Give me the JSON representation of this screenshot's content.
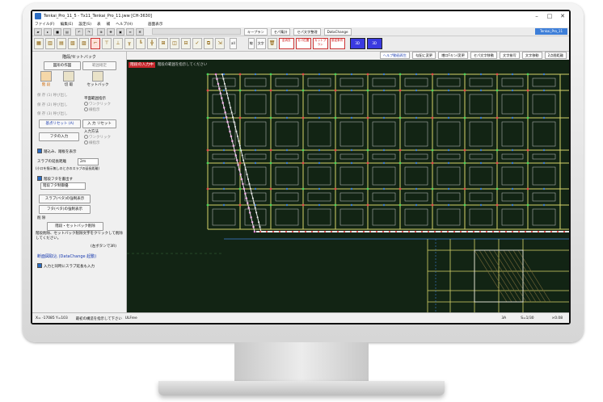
{
  "window": {
    "title": "Tenkai_Pro_11_5 - Tx11_Tenkai_Pro_11.jww [CH-3630]",
    "minimize_glyph": "–",
    "maximize_glyph": "□",
    "close_glyph": "✕"
  },
  "menu": [
    "ファイル(F)",
    "編集(E)",
    "設定(S)",
    "表",
    "補",
    "ヘルプ(H)",
    "画面表示"
  ],
  "toolbar1": {
    "buttons": [
      "キープラン",
      "セパ集計",
      "セパ文字整理",
      "DataChange"
    ],
    "status": "Tenkai_Pro_11"
  },
  "toolbar2": {
    "text_buttons": [
      "all",
      "線",
      "文字"
    ],
    "red_buttons": [
      "全消去",
      "セパ位置",
      "カットプラン",
      "設定条件"
    ],
    "blue_buttons": [
      "3D",
      "3D"
    ]
  },
  "panel": {
    "title": "階段/セットバック",
    "btn_dimension": "図形の作図",
    "btn_scope": "範囲確定",
    "icon_stairs": "階 段",
    "icon_cut": "切 取",
    "icon_setback": "セットバック",
    "row1": "保 存 (1) 呼び出し",
    "row2": "保 存 (2) 呼び出し",
    "row3": "保 存 (3) 呼び出し",
    "plane_label": "平面範囲指示",
    "radio_one_click": "ワンクリック",
    "radio_line": "線指示",
    "btn_base_reset": "基点リセット (A)",
    "btn_input_reset": "入 力 リセット",
    "btn_frame_input": "フタの入力",
    "input_method": "入力方法",
    "radio_one_click2": "ワンクリック",
    "radio_line2": "線指示",
    "chk_stairs_show": "踏込み、踏板を表示",
    "slab_label": "スラブの延長距離",
    "slab_value": "2m",
    "slab_note": "(小口を指示無しのときのスラブの延長距離)",
    "chk_frame": "階段フタを書出す",
    "select_frame": "階段フタ制御優",
    "btn_slab_show": "スラブ(ベタ)の強制表示",
    "btn_frame_show": "フタ(ベタ)の強制表示",
    "delete_label": "削 除",
    "btn_delete": "階段・セットバック削除",
    "delete_note": "階段削除、セットバック削除文字をクリックして削除してください。",
    "left_btn_note": "(左ボタンで3R)",
    "link_datachange": "断面図取込 (DataChange 起動)",
    "chk_auto_slab": "入力と同時にスラブ延長も入力"
  },
  "tabs": [
    "ヘルプ動画再生",
    "勾配に変更",
    "増口Fキン/変更",
    "セパ文字移動",
    "文字揃写",
    "文字移動",
    "2点間距離"
  ],
  "canvas": {
    "warning": "階段の入力中",
    "info": "階段の範囲を指示してください"
  },
  "status": {
    "coords": "X= -17085 Y=103",
    "message": "最初の構造を指示して下さい",
    "mode": "ULFree",
    "scale": "3A",
    "ratio": "S=1/30",
    "zoom": "×0.08"
  },
  "colors": {
    "canvas_bg": "#122414",
    "grid_line": "#d7d36a",
    "node_green": "#48d35a",
    "node_red": "#e04848",
    "node_blue": "#3d7ed8",
    "pink_marks": "#e36fd2",
    "white_line": "#e8e8e8"
  }
}
